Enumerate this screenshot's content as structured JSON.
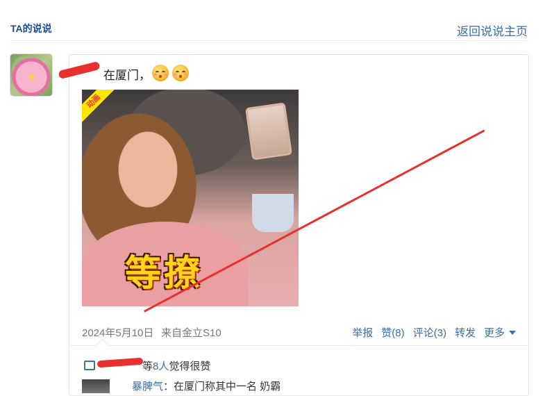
{
  "header": {
    "title": "TA的说说",
    "back_link": "返回说说主页"
  },
  "post": {
    "text": "在厦门，",
    "emojis": [
      "kissing-face-emoji",
      "kissing-face-emoji"
    ],
    "image": {
      "badge": "动画",
      "caption": "等撩"
    },
    "date": "2024年5月10日",
    "source": "来自金立S10",
    "actions": {
      "report": "举报",
      "like": "赞(8)",
      "comment": "评论(3)",
      "forward": "转发",
      "more": "更多"
    }
  },
  "likes": {
    "prefix": "等",
    "count": "8人",
    "suffix": "觉得很赞"
  },
  "comment": {
    "user": "暴脾气",
    "text": "：在厦门称其中一名     奶霸"
  },
  "colors": {
    "link": "#3a6ea5",
    "header_title": "#1f4e8c",
    "redaction": "#e8312f"
  }
}
